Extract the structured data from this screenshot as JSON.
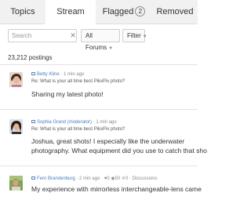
{
  "tabs": {
    "topics": "Topics",
    "stream": "Stream",
    "flagged": "Flagged",
    "flagged_count": "2",
    "removed": "Removed"
  },
  "filters": {
    "search_placeholder": "Search",
    "search_clear": "✕",
    "forums_label": "All Forums",
    "filter_label": "Filter",
    "caret": "▼"
  },
  "postings_count": "23,212 postings",
  "posts": [
    {
      "author": "Betty Kline",
      "time": " · 1 min ago",
      "reply": "Re: What is your all time best PikxPix photo?",
      "body": "Sharing my latest photo!"
    },
    {
      "author": "Sophia Grand (moderator)",
      "time": " · 1 min ago",
      "reply": "Re: What is your all time best PikxPix photo?",
      "body_line1": "Joshua, great shots! I especially like the underwater",
      "body_line2": "photography. What equipment did you use to catch that sho"
    },
    {
      "author": "Fern Brandenburg",
      "time": " · 2 min ago · ",
      "likes": "0",
      "comments": "50",
      "shares": "0",
      "category": "Discussions",
      "body": "My experience with mirrorless interchangeable-lens came"
    }
  ],
  "colors": {
    "tab_bar": "#f1f1f1",
    "author_link": "#4a7fbf"
  }
}
